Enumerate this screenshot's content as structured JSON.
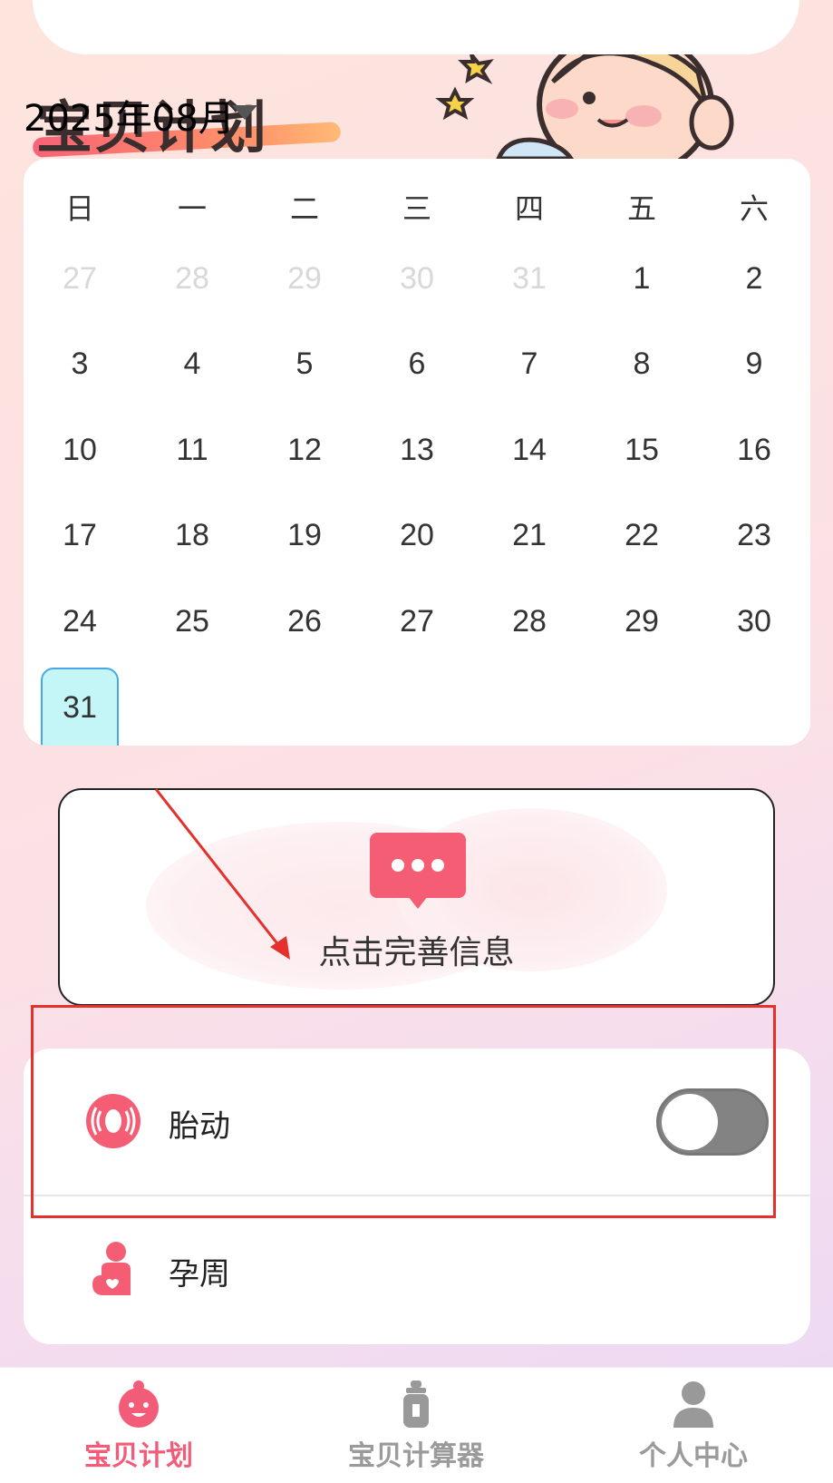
{
  "header": {
    "brand_title": "宝贝计划",
    "month_label": "2025年08月"
  },
  "calendar": {
    "weekdays": [
      "日",
      "一",
      "二",
      "三",
      "四",
      "五",
      "六"
    ],
    "weeks": [
      [
        {
          "d": "27",
          "muted": true
        },
        {
          "d": "28",
          "muted": true
        },
        {
          "d": "29",
          "muted": true
        },
        {
          "d": "30",
          "muted": true
        },
        {
          "d": "31",
          "muted": true
        },
        {
          "d": "1"
        },
        {
          "d": "2"
        }
      ],
      [
        {
          "d": "3"
        },
        {
          "d": "4"
        },
        {
          "d": "5"
        },
        {
          "d": "6"
        },
        {
          "d": "7"
        },
        {
          "d": "8"
        },
        {
          "d": "9"
        }
      ],
      [
        {
          "d": "10"
        },
        {
          "d": "11"
        },
        {
          "d": "12"
        },
        {
          "d": "13"
        },
        {
          "d": "14"
        },
        {
          "d": "15"
        },
        {
          "d": "16"
        }
      ],
      [
        {
          "d": "17"
        },
        {
          "d": "18"
        },
        {
          "d": "19"
        },
        {
          "d": "20"
        },
        {
          "d": "21"
        },
        {
          "d": "22"
        },
        {
          "d": "23"
        }
      ],
      [
        {
          "d": "24"
        },
        {
          "d": "25"
        },
        {
          "d": "26"
        },
        {
          "d": "27"
        },
        {
          "d": "28"
        },
        {
          "d": "29"
        },
        {
          "d": "30"
        }
      ],
      [
        {
          "d": "31",
          "today": true
        }
      ]
    ],
    "today_color": "#c4f6f8"
  },
  "info_card": {
    "label": "点击完善信息",
    "icon": "chat-bubble-icon"
  },
  "list": {
    "items": [
      {
        "label": "胎动",
        "icon": "fetal-movement-icon",
        "toggle_on": false
      },
      {
        "label": "孕周",
        "icon": "pregnancy-week-icon"
      }
    ]
  },
  "tabbar": {
    "tabs": [
      {
        "label": "宝贝计划",
        "icon": "baby-face-icon",
        "active": true
      },
      {
        "label": "宝贝计算器",
        "icon": "baby-bottle-icon",
        "active": false
      },
      {
        "label": "个人中心",
        "icon": "user-icon",
        "active": false
      }
    ]
  },
  "colors": {
    "accent": "#f25c78",
    "annotation_red": "#e5302b"
  }
}
